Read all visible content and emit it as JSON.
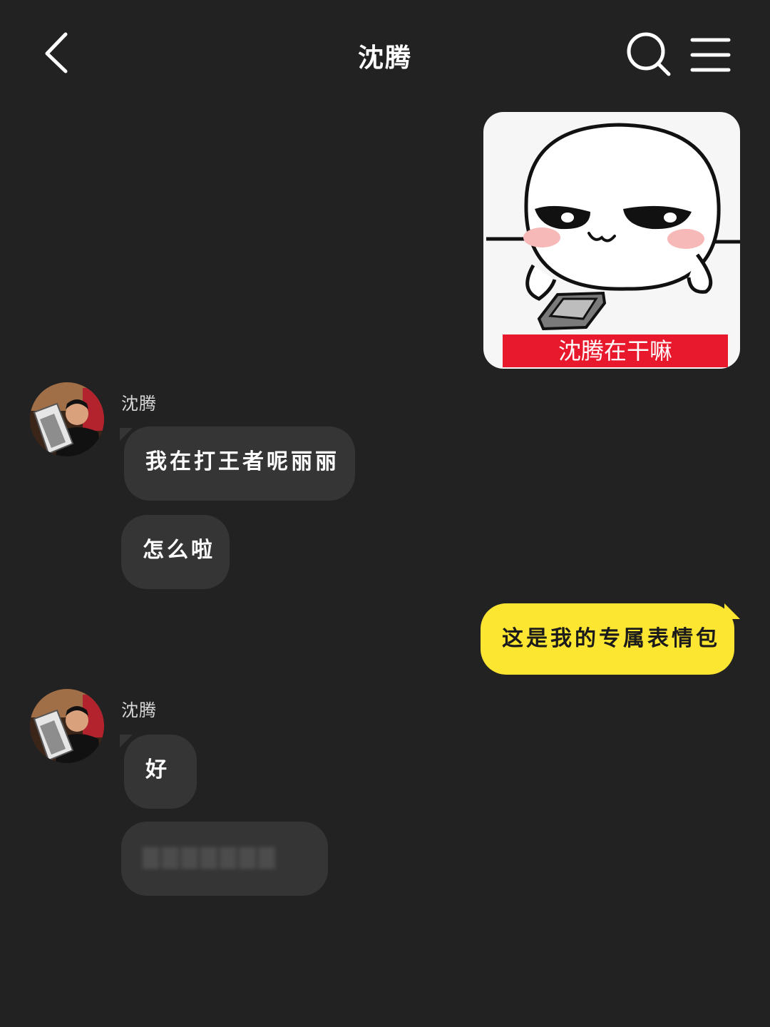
{
  "header": {
    "title": "沈腾",
    "back_icon": "chevron-left-icon",
    "search_icon": "search-icon",
    "menu_icon": "menu-icon"
  },
  "messages": [
    {
      "type": "sticker",
      "direction": "outgoing",
      "caption": "沈腾在干嘛"
    },
    {
      "direction": "incoming",
      "sender": "沈腾",
      "text": "我在打王者呢丽丽"
    },
    {
      "direction": "incoming",
      "text": "怎么啦"
    },
    {
      "direction": "outgoing",
      "text": "这是我的专属表情包"
    },
    {
      "direction": "incoming",
      "sender": "沈腾",
      "text": "好"
    },
    {
      "direction": "incoming",
      "text": "▇▇▇▇▇▇▇",
      "blurred": true
    }
  ],
  "colors": {
    "background": "#222222",
    "incoming_bubble": "#353535",
    "outgoing_bubble": "#fde631",
    "sticker_caption_bg": "#e8192c"
  }
}
